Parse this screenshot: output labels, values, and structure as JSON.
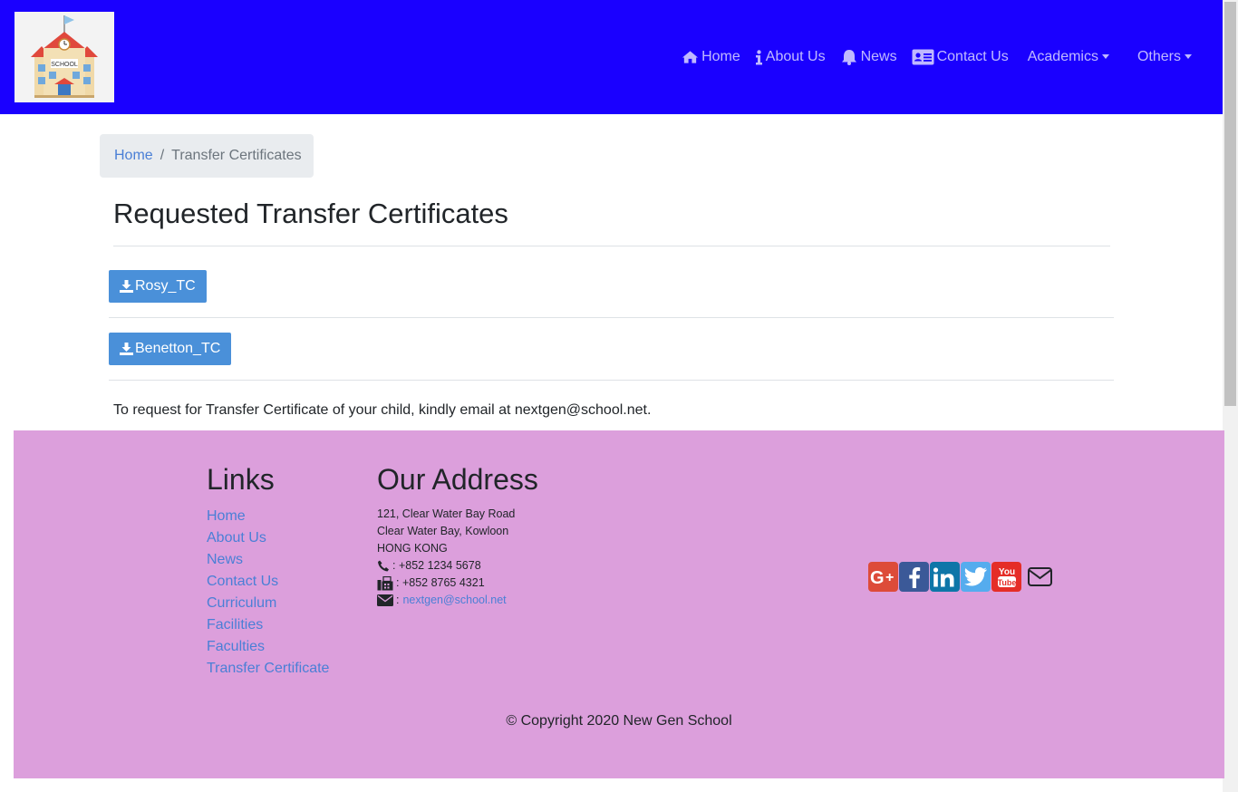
{
  "nav": {
    "logo_text": "SCHOOL",
    "items": [
      {
        "label": "Home",
        "icon": "home-icon"
      },
      {
        "label": "About Us",
        "icon": "info-icon"
      },
      {
        "label": "News",
        "icon": "bell-icon"
      },
      {
        "label": "Contact Us",
        "icon": "address-card-icon"
      },
      {
        "label": "Academics",
        "icon": "caret-down-icon"
      },
      {
        "label": "Others",
        "icon": "caret-down-icon"
      }
    ]
  },
  "breadcrumb": {
    "home": "Home",
    "separator": "/",
    "current": "Transfer Certificates"
  },
  "main": {
    "title": "Requested Transfer Certificates",
    "downloads": [
      {
        "label": "Rosy_TC",
        "icon": "download-icon"
      },
      {
        "label": "Benetton_TC",
        "icon": "download-icon"
      }
    ],
    "note": "To request for Transfer Certificate of your child, kindly email at nextgen@school.net."
  },
  "footer": {
    "links_title": "Links",
    "links": [
      "Home",
      "About Us",
      "News",
      "Contact Us",
      "Curriculum",
      "Facilities",
      "Faculties",
      "Transfer Certificate"
    ],
    "address_title": "Our Address",
    "address_lines": [
      "121, Clear Water Bay Road",
      "Clear Water Bay, Kowloon",
      "HONG KONG"
    ],
    "phone": ": +852 1234 5678",
    "fax": ": +852 8765 4321",
    "email_prefix": ":",
    "email": "nextgen@school.net",
    "social": [
      "google-plus-icon",
      "facebook-icon",
      "linkedin-icon",
      "twitter-icon",
      "youtube-icon",
      "envelope-icon"
    ],
    "copyright": "© Copyright 2020 New Gen School"
  },
  "colors": {
    "navbar_bg": "#1a00ff",
    "footer_bg": "#dc9fdc",
    "button_bg": "#4a90d9",
    "link": "#4a7fd6",
    "breadcrumb_bg": "#e9ecef"
  }
}
